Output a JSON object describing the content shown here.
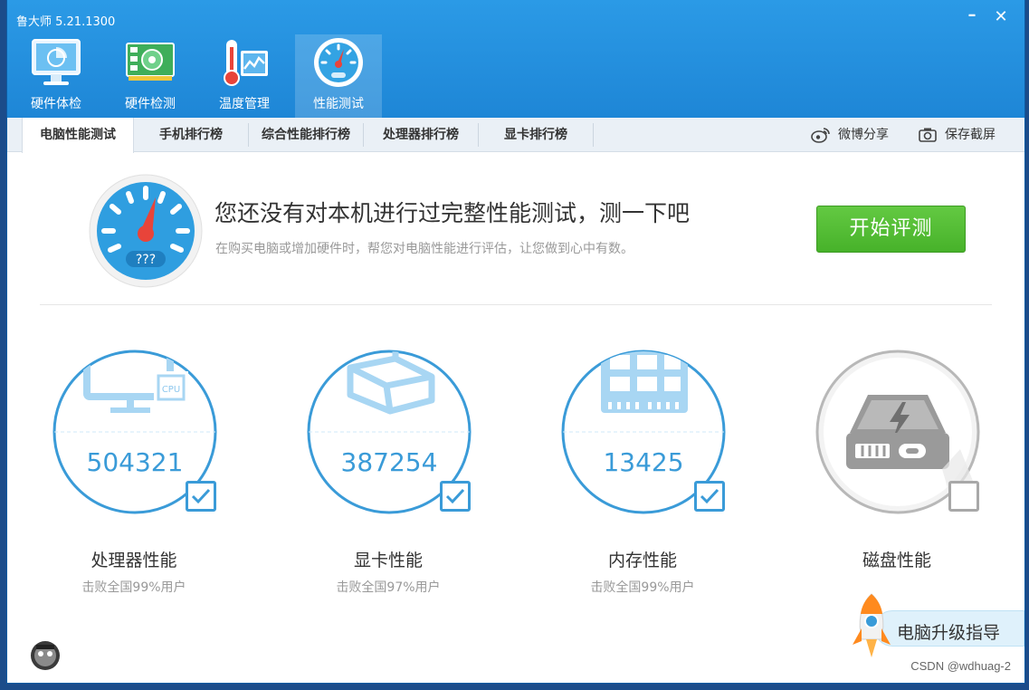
{
  "app": {
    "title": "鲁大师 5.21.1300",
    "minimize_glyph": "–",
    "close_glyph": "✕"
  },
  "top_tabs": [
    {
      "label": "硬件体检",
      "icon": "monitor-icon"
    },
    {
      "label": "硬件检测",
      "icon": "circuit-board-icon"
    },
    {
      "label": "温度管理",
      "icon": "thermometer-icon"
    },
    {
      "label": "性能测试",
      "icon": "gauge-icon",
      "active": true
    }
  ],
  "sub_tabs": [
    {
      "label": "电脑性能测试",
      "active": true
    },
    {
      "label": "手机排行榜"
    },
    {
      "label": "综合性能排行榜"
    },
    {
      "label": "处理器排行榜"
    },
    {
      "label": "显卡排行榜"
    }
  ],
  "actions": {
    "weibo_share": "微博分享",
    "save_screenshot": "保存截屏"
  },
  "hero": {
    "title": "您还没有对本机进行过完整性能测试，测一下吧",
    "subtitle": "在购买电脑或增加硬件时，帮您对电脑性能进行评估，让您做到心中有数。",
    "gauge_label": "???",
    "start_button": "开始评测"
  },
  "metrics": [
    {
      "name": "处理器性能",
      "score": "504321",
      "sub": "击败全国99%用户",
      "checked": true,
      "icon": "cpu-monitor-icon",
      "chip_label": "CPU"
    },
    {
      "name": "显卡性能",
      "score": "387254",
      "sub": "击败全国97%用户",
      "checked": true,
      "icon": "graphics-cube-icon"
    },
    {
      "name": "内存性能",
      "score": "13425",
      "sub": "击败全国99%用户",
      "checked": true,
      "icon": "memory-chip-icon"
    },
    {
      "name": "磁盘性能",
      "score": "",
      "sub": "",
      "checked": false,
      "icon": "disk-drive-icon"
    }
  ],
  "upgrade_guide": "电脑升级指导",
  "watermark": "CSDN @wdhuag-2",
  "colors": {
    "titlebar": "#1e86d6",
    "accent": "#3a9bd8",
    "green": "#47b22a",
    "gauge_needle": "#e8443a"
  }
}
